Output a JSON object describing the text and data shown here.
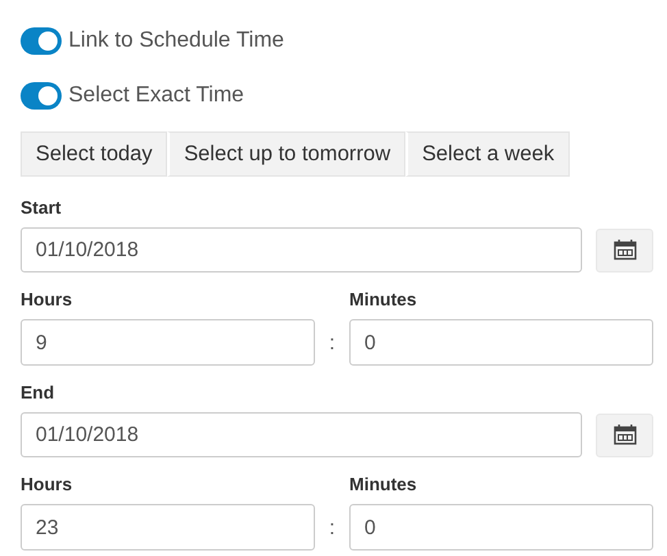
{
  "toggles": [
    {
      "label": "Link to Schedule Time",
      "on": true
    },
    {
      "label": "Select Exact Time",
      "on": true
    }
  ],
  "range_buttons": [
    "Select today",
    "Select up to tomorrow",
    "Select a week"
  ],
  "periods": [
    {
      "date_label": "Start",
      "date": "01/10/2018",
      "hours_label": "Hours",
      "hours": "9",
      "separator": ":",
      "minutes_label": "Minutes",
      "minutes": "0"
    },
    {
      "date_label": "End",
      "date": "01/10/2018",
      "hours_label": "Hours",
      "hours": "23",
      "separator": ":",
      "minutes_label": "Minutes",
      "minutes": "0"
    }
  ]
}
